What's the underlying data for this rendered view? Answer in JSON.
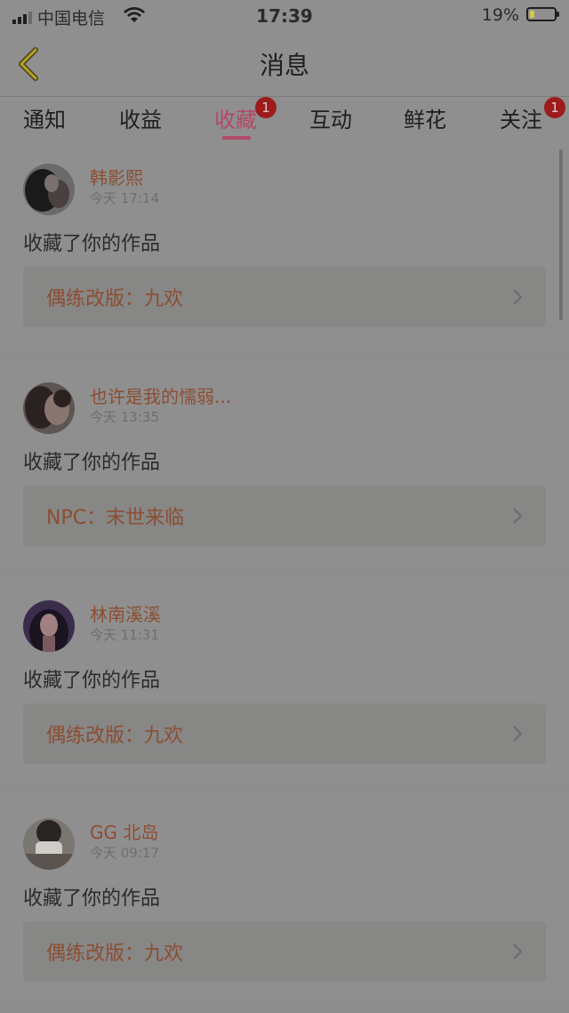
{
  "status_bar": {
    "carrier": "中国电信",
    "time": "17:39",
    "battery_percent": "19%",
    "battery_level": 0.19
  },
  "header": {
    "title": "消息",
    "back_icon": "chevron-left-icon"
  },
  "tabs": [
    {
      "label": "通知",
      "badge": ""
    },
    {
      "label": "收益",
      "badge": ""
    },
    {
      "label": "收藏",
      "badge": "1",
      "active": true
    },
    {
      "label": "互动",
      "badge": ""
    },
    {
      "label": "鲜花",
      "badge": ""
    },
    {
      "label": "关注",
      "badge": "1"
    }
  ],
  "messages": [
    {
      "username": "韩影熙",
      "time": "今天 17:14",
      "action": "收藏了你的作品",
      "work_title": "偶练改版：九欢"
    },
    {
      "username": "也许是我的懦弱...",
      "time": "今天 13:35",
      "action": "收藏了你的作品",
      "work_title": "NPC：末世来临"
    },
    {
      "username": "林南溪溪",
      "time": "今天 11:31",
      "action": "收藏了你的作品",
      "work_title": "偶练改版：九欢"
    },
    {
      "username": "GG 北岛",
      "time": "今天 09:17",
      "action": "收藏了你的作品",
      "work_title": "偶练改版：九欢"
    }
  ],
  "colors": {
    "accent": "#b34868",
    "username": "#8c4d32",
    "badge": "#9c1c1c",
    "back_icon": "#b0a030"
  }
}
